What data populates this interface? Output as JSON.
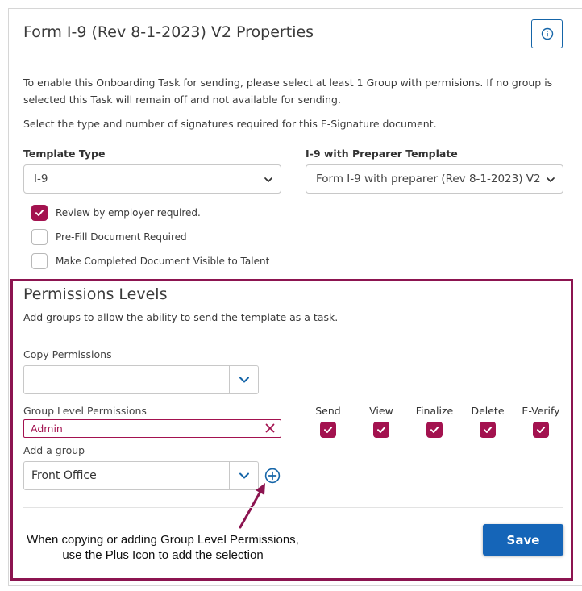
{
  "header": {
    "title": "Form I-9 (Rev 8-1-2023) V2 Properties",
    "info_icon": "info-circle-icon"
  },
  "intro": {
    "paragraph1": "To enable this Onboarding Task for sending, please select at least 1 Group with permisions. If no group is selected this Task will remain off and not available for sending.",
    "paragraph2": "Select the type and number of signatures required for this E-Signature document."
  },
  "template_type": {
    "label": "Template Type",
    "value": "I-9"
  },
  "preparer_template": {
    "label": "I-9 with Preparer Template",
    "value": "Form I-9 with preparer (Rev 8-1-2023) V2"
  },
  "options": [
    {
      "label": "Review by employer required.",
      "checked": true
    },
    {
      "label": "Pre-Fill Document Required",
      "checked": false
    },
    {
      "label": "Make Completed Document Visible to Talent",
      "checked": false
    }
  ],
  "permissions": {
    "title": "Permissions Levels",
    "description": "Add groups to allow the ability to send the template as a task.",
    "copy_label": "Copy Permissions",
    "copy_value": "",
    "group_level_label": "Group Level Permissions",
    "groups": [
      {
        "name": "Admin"
      }
    ],
    "columns": [
      {
        "label": "Send",
        "checked": true
      },
      {
        "label": "View",
        "checked": true
      },
      {
        "label": "Finalize",
        "checked": true
      },
      {
        "label": "Delete",
        "checked": true
      },
      {
        "label": "E-Verify",
        "checked": true
      }
    ],
    "add_group_label": "Add a group",
    "add_group_value": "Front Office"
  },
  "annotation": {
    "line1": "When copying or adding Group Level Permissions,",
    "line2": "use the Plus Icon to add the selection"
  },
  "actions": {
    "save_label": "Save"
  },
  "colors": {
    "accent": "#a3124f",
    "highlight_border": "#8c1450",
    "primary_button": "#1565b8"
  }
}
